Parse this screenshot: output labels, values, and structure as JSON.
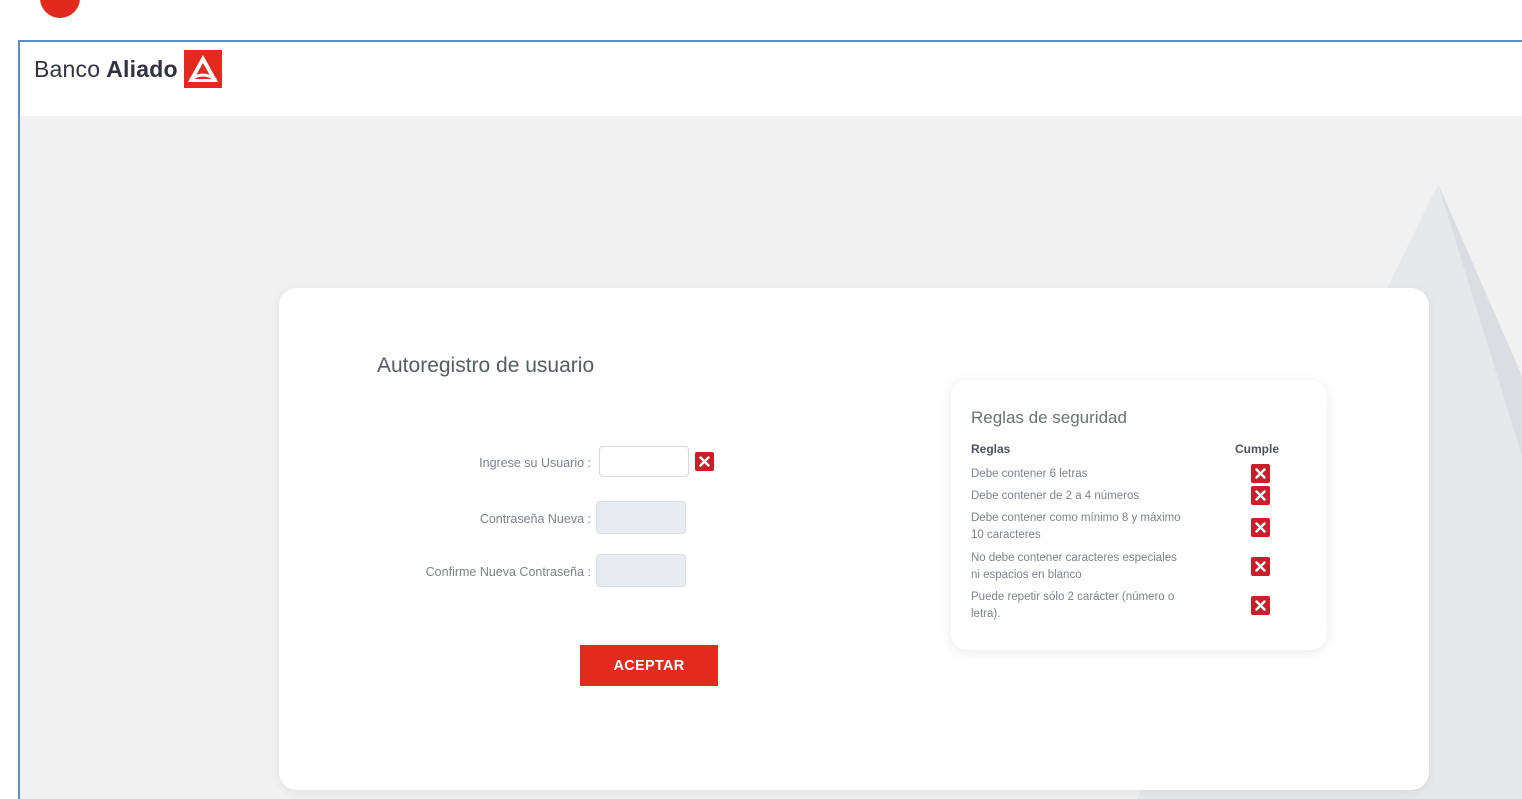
{
  "brand": {
    "name_regular": "Banco",
    "name_bold": "Aliado",
    "accent_color": "#e32a1f"
  },
  "form": {
    "title": "Autoregistro de usuario",
    "user_label": "Ingrese su Usuario :",
    "user_value": "",
    "new_password_label": "Contraseña Nueva :",
    "confirm_password_label": "Confirme Nueva Contraseña :",
    "submit_label": "ACEPTAR",
    "user_status_icon": "close-icon"
  },
  "rules": {
    "title": "Reglas de seguridad",
    "col_rules": "Reglas",
    "col_complies": "Cumple",
    "items": [
      {
        "text": "Debe contener 6 letras",
        "complies": false
      },
      {
        "text": "Debe contener de 2 a 4 números",
        "complies": false
      },
      {
        "text": "Debe contener como mínimo 8 y máximo 10 caracteres",
        "complies": false
      },
      {
        "text": "No debe contener caracteres especiales ni espacios en blanco",
        "complies": false
      },
      {
        "text": "Puede repetir sólo 2 carácter (número o letra).",
        "complies": false
      }
    ]
  }
}
